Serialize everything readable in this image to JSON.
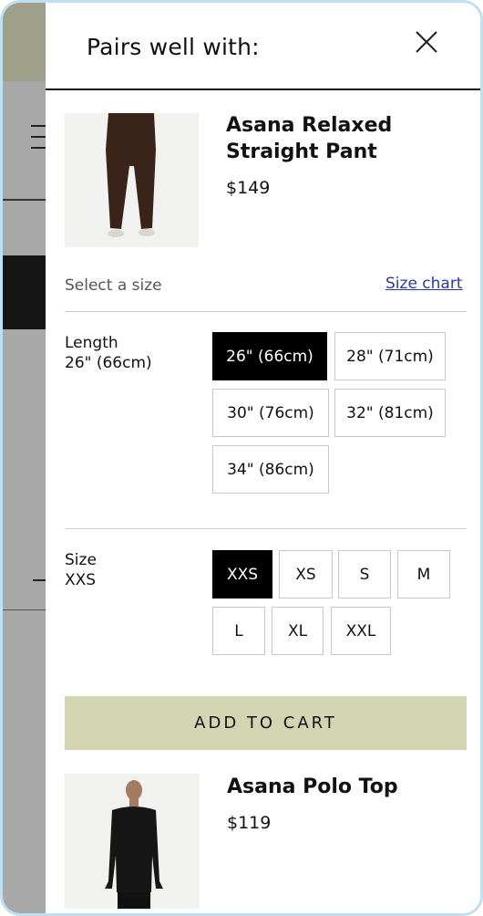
{
  "header": {
    "title": "Pairs well with:"
  },
  "products": [
    {
      "name_line1": "Asana Relaxed",
      "name_line2": "Straight Pant",
      "price": "$149",
      "select_size_label": "Select a size",
      "size_chart_label": "Size chart",
      "length": {
        "label": "Length",
        "selected": "26\" (66cm)",
        "options": [
          "26\" (66cm)",
          "28\" (71cm)",
          "30\" (76cm)",
          "32\" (81cm)",
          "34\" (86cm)"
        ]
      },
      "size": {
        "label": "Size",
        "selected": "XXS",
        "options": [
          "XXS",
          "XS",
          "S",
          "M",
          "L",
          "XL",
          "XXL"
        ]
      },
      "add_to_cart": "ADD TO CART"
    },
    {
      "name": "Asana Polo Top",
      "price": "$119"
    }
  ],
  "icons": {
    "close": "close-icon"
  },
  "colors": {
    "accent_button": "#d3d4b2",
    "selected_chip": "#000000",
    "link": "#2b3b9c"
  }
}
